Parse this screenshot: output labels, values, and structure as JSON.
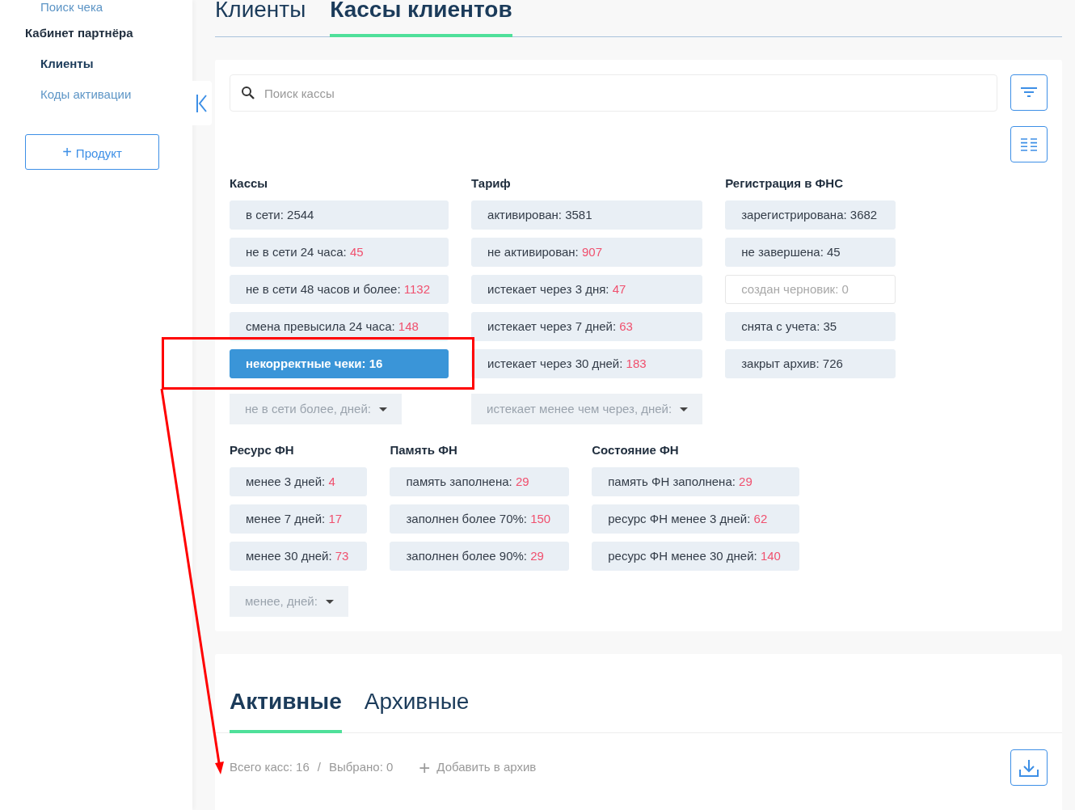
{
  "sidebar": {
    "items": [
      {
        "label": "Поиск чека",
        "kind": "link",
        "selected": false
      },
      {
        "label": "Кабинет партнёра",
        "kind": "section"
      },
      {
        "label": "Клиенты",
        "kind": "link",
        "selected": true
      },
      {
        "label": "Коды активации",
        "kind": "link",
        "selected": false
      }
    ],
    "add_button": {
      "icon": "+",
      "label": "Продукт"
    }
  },
  "tabs": [
    {
      "label": "Клиенты",
      "selected": false
    },
    {
      "label": "Кассы клиентов",
      "selected": true
    }
  ],
  "search": {
    "placeholder": "Поиск кассы"
  },
  "filter_rows": [
    [
      {
        "title": "Кассы",
        "items": [
          {
            "kind": "chip",
            "label": "в сети: ",
            "count": "2544",
            "alert": false,
            "selected": false,
            "disabled": false
          },
          {
            "kind": "chip",
            "label": "не в сети 24 часа: ",
            "count": "45",
            "alert": true,
            "selected": false,
            "disabled": false
          },
          {
            "kind": "chip",
            "label": "не в сети 48 часов и более: ",
            "count": "1132",
            "alert": true,
            "selected": false,
            "disabled": false
          },
          {
            "kind": "chip",
            "label": "смена превысила 24 часа: ",
            "count": "148",
            "alert": true,
            "selected": false,
            "disabled": false
          },
          {
            "kind": "chip",
            "label": "некорректные чеки: ",
            "count": "16",
            "alert": false,
            "selected": true,
            "disabled": false
          },
          {
            "kind": "dropdown",
            "label": "не в сети более, дней:"
          }
        ]
      },
      {
        "title": "Тариф",
        "items": [
          {
            "kind": "chip",
            "label": "активирован: ",
            "count": "3581",
            "alert": false,
            "selected": false,
            "disabled": false
          },
          {
            "kind": "chip",
            "label": "не активирован: ",
            "count": "907",
            "alert": true,
            "selected": false,
            "disabled": false
          },
          {
            "kind": "chip",
            "label": "истекает через 3 дня: ",
            "count": "47",
            "alert": true,
            "selected": false,
            "disabled": false
          },
          {
            "kind": "chip",
            "label": "истекает через 7 дней: ",
            "count": "63",
            "alert": true,
            "selected": false,
            "disabled": false
          },
          {
            "kind": "chip",
            "label": "истекает через 30 дней: ",
            "count": "183",
            "alert": true,
            "selected": false,
            "disabled": false
          },
          {
            "kind": "dropdown",
            "label": "истекает менее чем через, дней:"
          }
        ]
      },
      {
        "title": "Регистрация в ФНС",
        "items": [
          {
            "kind": "chip",
            "label": "зарегистрирована: ",
            "count": "3682",
            "alert": false,
            "selected": false,
            "disabled": false
          },
          {
            "kind": "chip",
            "label": "не завершена: ",
            "count": "45",
            "alert": false,
            "selected": false,
            "disabled": false
          },
          {
            "kind": "chip",
            "label": "создан черновик: ",
            "count": "0",
            "alert": false,
            "selected": false,
            "disabled": true
          },
          {
            "kind": "chip",
            "label": "снята с учета: ",
            "count": "35",
            "alert": false,
            "selected": false,
            "disabled": false
          },
          {
            "kind": "chip",
            "label": "закрыт архив: ",
            "count": "726",
            "alert": false,
            "selected": false,
            "disabled": false
          }
        ]
      }
    ],
    [
      {
        "title": "Ресурс ФН",
        "items": [
          {
            "kind": "chip",
            "label": "менее 3 дней: ",
            "count": "4",
            "alert": true,
            "selected": false,
            "disabled": false
          },
          {
            "kind": "chip",
            "label": "менее 7 дней: ",
            "count": "17",
            "alert": true,
            "selected": false,
            "disabled": false
          },
          {
            "kind": "chip",
            "label": "менее 30 дней: ",
            "count": "73",
            "alert": true,
            "selected": false,
            "disabled": false
          },
          {
            "kind": "dropdown",
            "label": "менее, дней:"
          }
        ]
      },
      {
        "title": "Память ФН",
        "items": [
          {
            "kind": "chip",
            "label": "память заполнена: ",
            "count": "29",
            "alert": true,
            "selected": false,
            "disabled": false
          },
          {
            "kind": "chip",
            "label": "заполнен более 70%: ",
            "count": "150",
            "alert": true,
            "selected": false,
            "disabled": false
          },
          {
            "kind": "chip",
            "label": "заполнен более 90%: ",
            "count": "29",
            "alert": true,
            "selected": false,
            "disabled": false
          }
        ]
      },
      {
        "title": "Состояние ФН",
        "items": [
          {
            "kind": "chip",
            "label": "память ФН заполнена: ",
            "count": "29",
            "alert": true,
            "selected": false,
            "disabled": false
          },
          {
            "kind": "chip",
            "label": "ресурс ФН менее 3 дней: ",
            "count": "62",
            "alert": true,
            "selected": false,
            "disabled": false
          },
          {
            "kind": "chip",
            "label": "ресурс ФН менее 30 дней: ",
            "count": "140",
            "alert": true,
            "selected": false,
            "disabled": false
          }
        ]
      }
    ]
  ],
  "list_tabs": [
    {
      "label": "Активные",
      "selected": true
    },
    {
      "label": "Архивные",
      "selected": false
    }
  ],
  "summary": {
    "total": "Всего касс: 16",
    "separator": "/",
    "selected": "Выбрано: 0",
    "action_icon": "+",
    "action": "Добавить в архив"
  },
  "annotation": {
    "kind": "highlight-with-arrow"
  }
}
